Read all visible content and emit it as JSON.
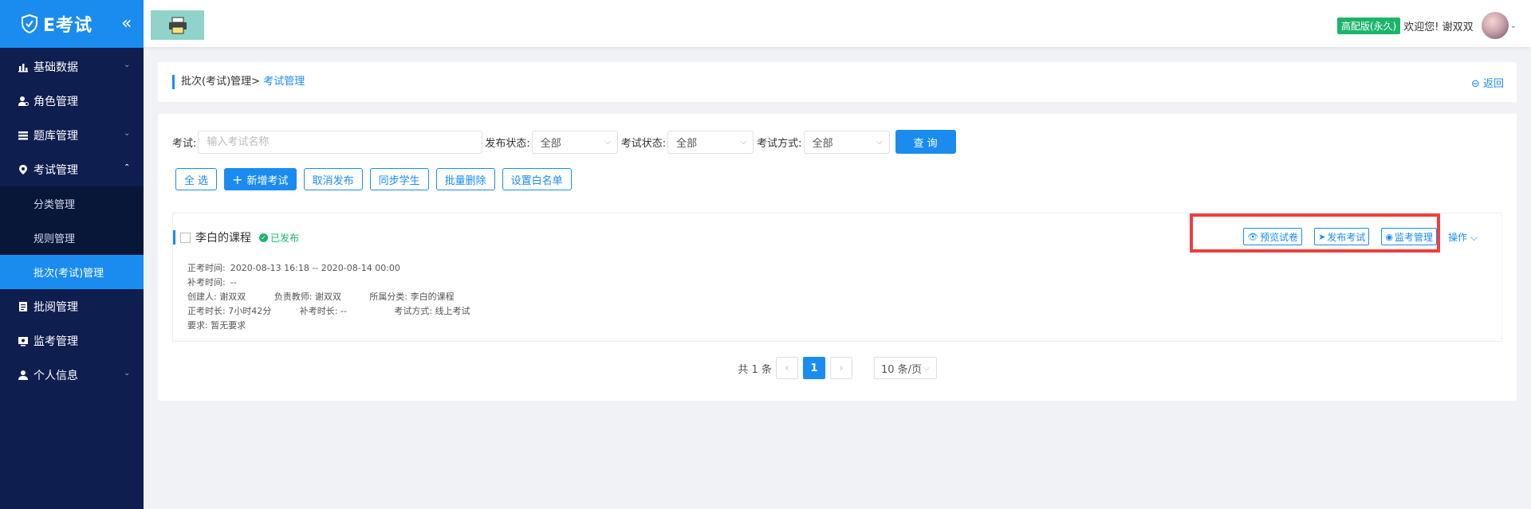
{
  "sidebar": {
    "logo_text": "E考试",
    "collapse_glyph": "«",
    "items": [
      {
        "label": "基础数据",
        "icon": "chart-icon",
        "has_sub": true
      },
      {
        "label": "角色管理",
        "icon": "user-role-icon",
        "has_sub": false
      },
      {
        "label": "题库管理",
        "icon": "list-icon",
        "has_sub": true
      },
      {
        "label": "考试管理",
        "icon": "location-icon",
        "has_sub": true,
        "expanded": true
      },
      {
        "label": "批阅管理",
        "icon": "note-icon",
        "has_sub": false
      },
      {
        "label": "监考管理",
        "icon": "monitor-icon",
        "has_sub": false
      },
      {
        "label": "个人信息",
        "icon": "person-icon",
        "has_sub": true
      }
    ],
    "sub_items": [
      {
        "label": "分类管理"
      },
      {
        "label": "规则管理"
      },
      {
        "label": "批次(考试)管理",
        "active": true
      }
    ]
  },
  "header": {
    "badge": "高配版(永久)",
    "welcome": "欢迎您! 谢双双"
  },
  "breadcrumb": {
    "parent": "批次(考试)管理>",
    "current": "考试管理",
    "back_label": "返回"
  },
  "filters": {
    "exam_label": "考试:",
    "exam_placeholder": "输入考试名称",
    "publish_label": "发布状态:",
    "publish_value": "全部",
    "exam_status_label": "考试状态:",
    "exam_status_value": "全部",
    "exam_mode_label": "考试方式:",
    "exam_mode_value": "全部",
    "query_label": "查 询"
  },
  "actions": {
    "select_all": "全 选",
    "add_exam": "新增考试",
    "cancel_publish": "取消发布",
    "sync_students": "同步学生",
    "batch_delete": "批量删除",
    "set_whitelist": "设置白名单"
  },
  "exam_card": {
    "title": "李白的课程",
    "status": "已发布",
    "ops": {
      "preview": "预览试卷",
      "publish": "发布考试",
      "monitor": "监考管理",
      "more": "操作"
    },
    "info": {
      "formal_time_label": "正考时间:",
      "formal_time_value": "2020-08-13 16:18 -- 2020-08-14 00:00",
      "makeup_time_label": "补考时间:",
      "makeup_time_value": "--",
      "creator": "创建人: 谢双双",
      "teacher": "负责教师: 谢双双",
      "category": "所属分类: 李白的课程",
      "formal_duration": "正考时长: 7小时42分",
      "makeup_duration": "补考时长: --",
      "exam_mode": "考试方式: 线上考试",
      "requirement": "要求: 暂无要求"
    }
  },
  "pagination": {
    "total": "共 1 条",
    "current_page": "1",
    "page_size": "10 条/页"
  },
  "colors": {
    "primary": "#1a8cf0",
    "sidebar_bg": "#0e1e4f",
    "success": "#1bb56a",
    "highlight": "#f23d3d"
  }
}
